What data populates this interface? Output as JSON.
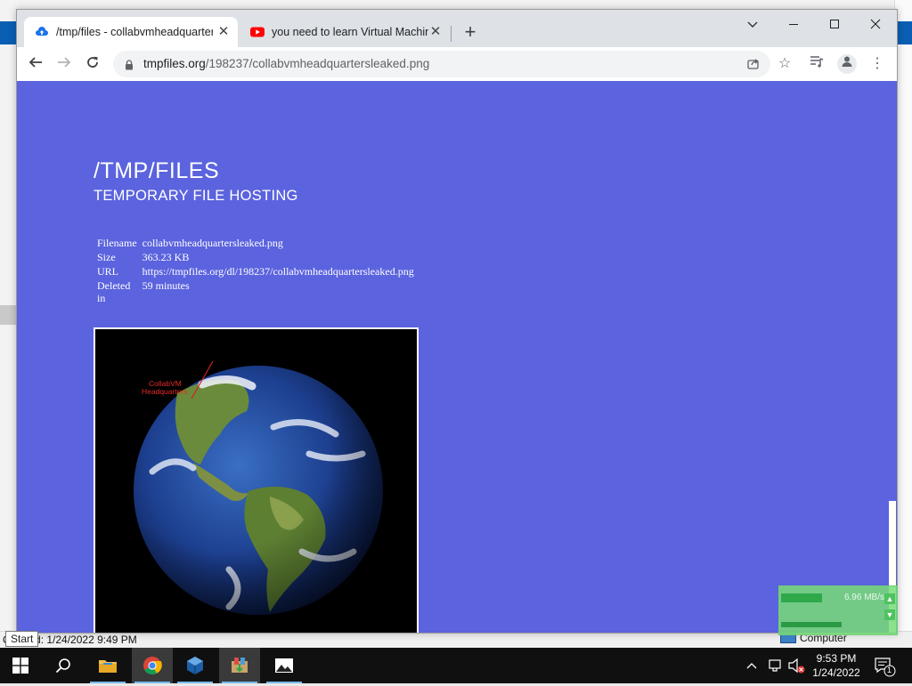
{
  "desktop": {
    "status_text": "Created: 1/24/2022 9:49 PM",
    "start_tooltip": "Start",
    "computer_label": "Computer"
  },
  "browser": {
    "tabs": [
      {
        "title": "/tmp/files - collabvmheadquartersleaked.png",
        "icon": "cloud-upload-icon",
        "active": true
      },
      {
        "title": "you need to learn Virtual Machine",
        "icon": "youtube-icon",
        "active": false
      }
    ],
    "address": {
      "host": "tmpfiles.org",
      "path": "/198237/collabvmheadquartersleaked.png"
    }
  },
  "page": {
    "title": "/TMP/FILES",
    "subtitle": "TEMPORARY FILE HOSTING",
    "info_rows": [
      {
        "key": "Filename",
        "value": "collabvmheadquartersleaked.png"
      },
      {
        "key": "Size",
        "value": "363.23 KB"
      },
      {
        "key": "URL",
        "value": "https://tmpfiles.org/dl/198237/collabvmheadquartersleaked.png"
      },
      {
        "key": "Deleted in",
        "value": "59 minutes"
      }
    ],
    "image_annotation": [
      "CollabVM",
      "Headquarters"
    ],
    "background_color": "#5b63de"
  },
  "tray_widget": {
    "speed_text": "6.96 MB/s"
  },
  "taskbar": {
    "apps": [
      "start-button",
      "search-icon",
      "file-explorer-icon",
      "chrome-icon",
      "virtualbox-icon",
      "package-icon",
      "photos-icon"
    ],
    "clock_time": "9:53 PM",
    "clock_date": "1/24/2022",
    "notification_count": "1"
  }
}
